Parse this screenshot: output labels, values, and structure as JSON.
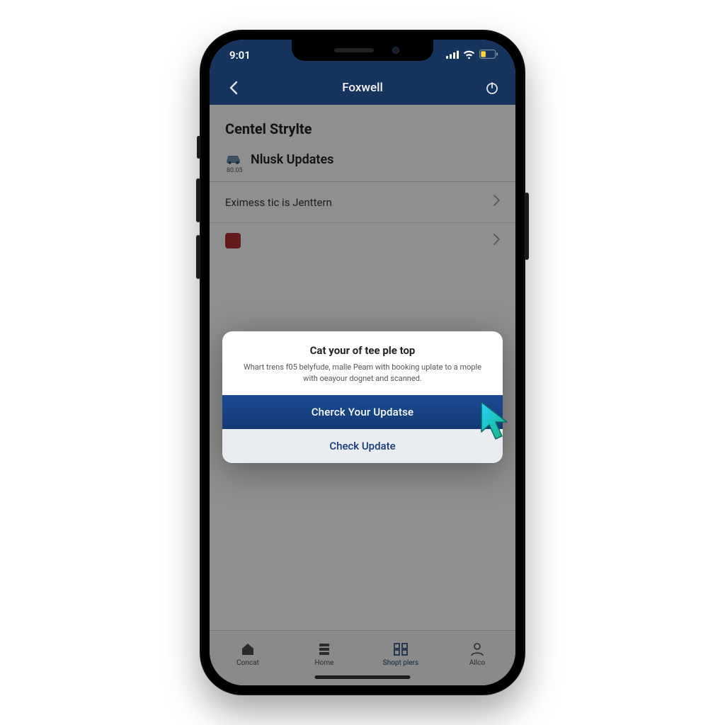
{
  "status": {
    "time": "9:01"
  },
  "nav": {
    "title": "Foxwell"
  },
  "section": {
    "title": "Centel Strylte",
    "updates_label": "Nlusk Updates",
    "updates_sub": "80.05"
  },
  "list": {
    "item1": "Eximess tic is Jenttern"
  },
  "popup": {
    "title": "Cat your of tee ple top",
    "body": "Whart trens f05 belyfude, malle Peam with booking uplate to a mople with oeayour dognet and scanned.",
    "primary": "Cherck Your Updatse",
    "secondary": "Check Update"
  },
  "tabs": {
    "t1": "Concat",
    "t2": "Home",
    "t3": "Shopt plers",
    "t4": "Allco"
  }
}
